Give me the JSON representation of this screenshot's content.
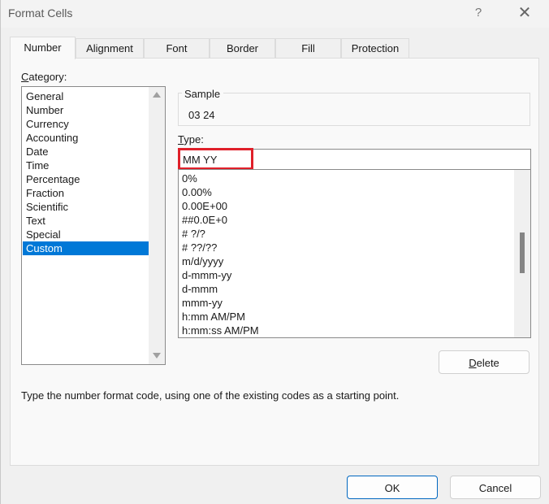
{
  "window": {
    "title": "Format Cells",
    "help_label": "?",
    "close_label": "✕"
  },
  "tabs": [
    {
      "label": "Number",
      "active": true
    },
    {
      "label": "Alignment",
      "active": false
    },
    {
      "label": "Font",
      "active": false
    },
    {
      "label": "Border",
      "active": false
    },
    {
      "label": "Fill",
      "active": false
    },
    {
      "label": "Protection",
      "active": false
    }
  ],
  "category": {
    "label_accel": "C",
    "label_rest": "ategory:",
    "items": [
      "General",
      "Number",
      "Currency",
      "Accounting",
      "Date",
      "Time",
      "Percentage",
      "Fraction",
      "Scientific",
      "Text",
      "Special",
      "Custom"
    ],
    "selected": "Custom"
  },
  "sample": {
    "label": "Sample",
    "value": "03 24"
  },
  "type": {
    "label_accel": "T",
    "label_rest": "ype:",
    "value": "MM YY",
    "list": [
      "0%",
      "0.00%",
      "0.00E+00",
      "##0.0E+0",
      "# ?/?",
      "# ??/??",
      "m/d/yyyy",
      "d-mmm-yy",
      "d-mmm",
      "mmm-yy",
      "h:mm AM/PM",
      "h:mm:ss AM/PM"
    ]
  },
  "buttons": {
    "delete_accel": "D",
    "delete_rest": "elete",
    "ok": "OK",
    "cancel": "Cancel"
  },
  "hint": "Type the number format code, using one of the existing codes as a starting point.",
  "colors": {
    "selection": "#0078d7",
    "highlight_border": "#e0202a",
    "ok_border": "#0067c0"
  }
}
